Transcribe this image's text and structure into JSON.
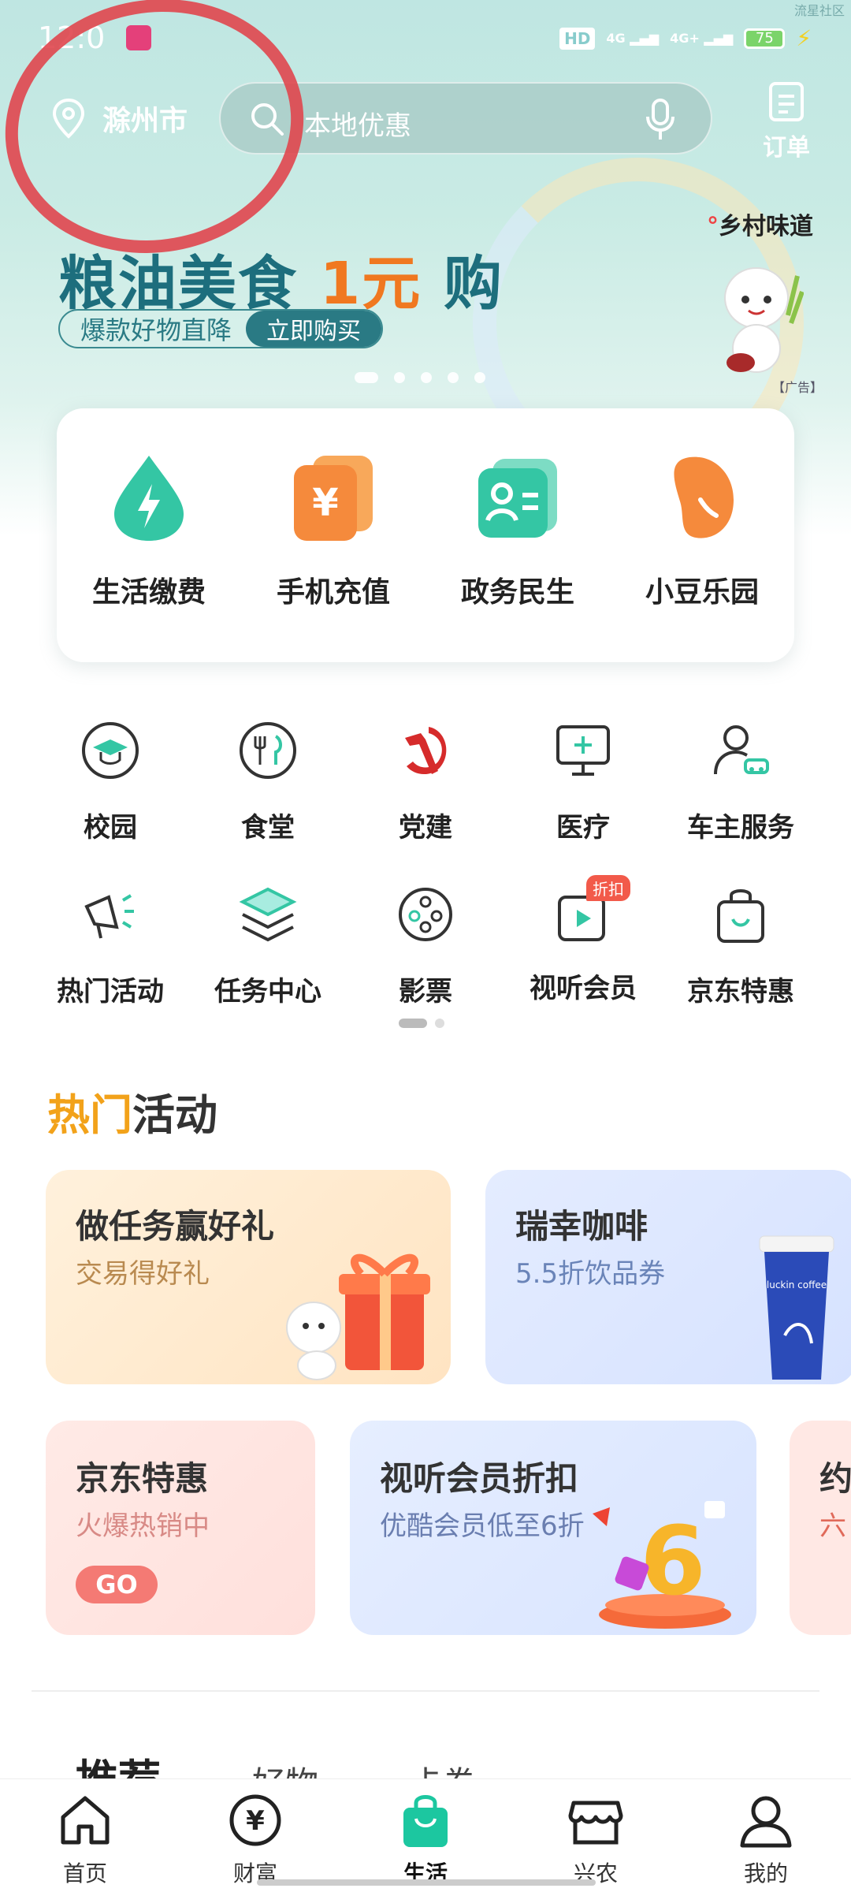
{
  "status_bar": {
    "time": "12:0",
    "battery": "75",
    "corner_text": "流星社区"
  },
  "header": {
    "location": "滁州市",
    "search_placeholder": "本地优惠",
    "orders_label": "订单"
  },
  "banner": {
    "brand": "乡村味道",
    "title_pre": "粮油美食",
    "title_hl": "1元",
    "title_post": "购",
    "subtitle": "爆款好物直降",
    "cta": "立即购买",
    "ad_label": "【广告】",
    "slides": 5,
    "active_slide": 1
  },
  "services": [
    {
      "label": "生活缴费",
      "icon": "lightning-drop-icon",
      "color": "#34c6a4"
    },
    {
      "label": "手机充值",
      "icon": "yuan-card-icon",
      "color": "#f58a3c"
    },
    {
      "label": "政务民生",
      "icon": "id-card-icon",
      "color": "#34c6a4"
    },
    {
      "label": "小豆乐园",
      "icon": "bean-icon",
      "color": "#f58a3c"
    }
  ],
  "shortcuts": [
    {
      "label": "校园",
      "icon": "graduation-cap-icon"
    },
    {
      "label": "食堂",
      "icon": "utensils-icon"
    },
    {
      "label": "党建",
      "icon": "hammer-sickle-icon"
    },
    {
      "label": "医疗",
      "icon": "monitor-cross-icon"
    },
    {
      "label": "车主服务",
      "icon": "user-car-icon"
    },
    {
      "label": "热门活动",
      "icon": "megaphone-icon"
    },
    {
      "label": "任务中心",
      "icon": "layers-icon"
    },
    {
      "label": "影票",
      "icon": "film-reel-icon"
    },
    {
      "label": "视听会员",
      "icon": "play-card-icon",
      "badge": "折扣"
    },
    {
      "label": "京东特惠",
      "icon": "shopping-bag-icon"
    }
  ],
  "hot": {
    "title_a": "热门",
    "title_b": "活动",
    "cards": [
      {
        "title": "做任务赢好礼",
        "subtitle": "交易得好礼"
      },
      {
        "title": "瑞幸咖啡",
        "subtitle": "5.5折饮品券",
        "cup_text": "luckin coffee"
      },
      {
        "title": "京东特惠",
        "subtitle": "火爆热销中",
        "go": "GO"
      },
      {
        "title": "视听会员折扣",
        "subtitle": "优酷会员低至6折",
        "big_number": "6"
      },
      {
        "title": "约",
        "subtitle": "六"
      }
    ]
  },
  "feed_tabs": [
    "推荐",
    "好物",
    "卡券"
  ],
  "bottom_nav": [
    {
      "label": "首页",
      "icon": "home-icon"
    },
    {
      "label": "财富",
      "icon": "yuan-coin-icon"
    },
    {
      "label": "生活",
      "icon": "shopping-bag-icon",
      "active": true
    },
    {
      "label": "兴农",
      "icon": "store-icon"
    },
    {
      "label": "我的",
      "icon": "user-icon"
    }
  ],
  "colors": {
    "accent": "#1cc7a0",
    "banner_text": "#1d6e7d",
    "highlight": "#f07820",
    "annotation_circle": "#e0464e"
  }
}
